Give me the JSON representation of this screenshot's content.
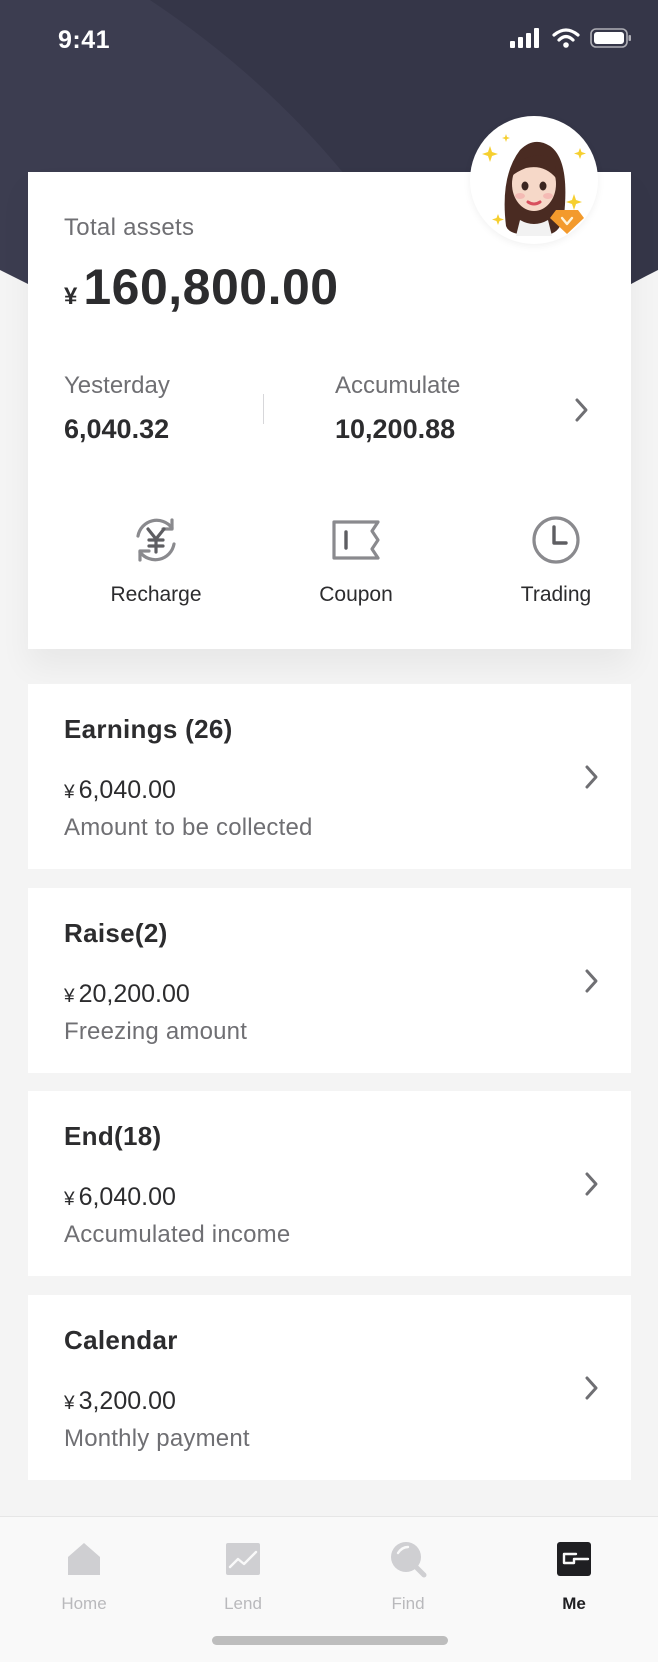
{
  "status_bar": {
    "time": "9:41"
  },
  "assets": {
    "total_label": "Total assets",
    "currency": "¥",
    "total_amount": "160,800.00",
    "yesterday_label": "Yesterday",
    "yesterday_value": "6,040.32",
    "accumulate_label": "Accumulate",
    "accumulate_value": "10,200.88"
  },
  "actions": [
    {
      "label": "Recharge",
      "icon": "recharge-icon"
    },
    {
      "label": "Coupon",
      "icon": "coupon-icon"
    },
    {
      "label": "Trading",
      "icon": "clock-icon"
    }
  ],
  "cards": [
    {
      "title": "Earnings (26)",
      "currency": "¥",
      "amount": "6,040.00",
      "desc": "Amount to be collected"
    },
    {
      "title": "Raise(2)",
      "currency": "¥",
      "amount": "20,200.00",
      "desc": "Freezing amount"
    },
    {
      "title": "End(18)",
      "currency": "¥",
      "amount": "6,040.00",
      "desc": "Accumulated income"
    },
    {
      "title": "Calendar",
      "currency": "¥",
      "amount": "3,200.00",
      "desc": "Monthly payment"
    }
  ],
  "tabs": [
    {
      "label": "Home",
      "icon": "home-icon",
      "active": false
    },
    {
      "label": "Lend",
      "icon": "chart-icon",
      "active": false
    },
    {
      "label": "Find",
      "icon": "search-icon",
      "active": false
    },
    {
      "label": "Me",
      "icon": "profile-card-icon",
      "active": true
    }
  ],
  "colors": {
    "header": "#3c3d50",
    "background": "#f4f4f4",
    "text": "#2c2c2e",
    "muted": "#6f6f73",
    "tab_inactive": "#b9b9bc"
  }
}
